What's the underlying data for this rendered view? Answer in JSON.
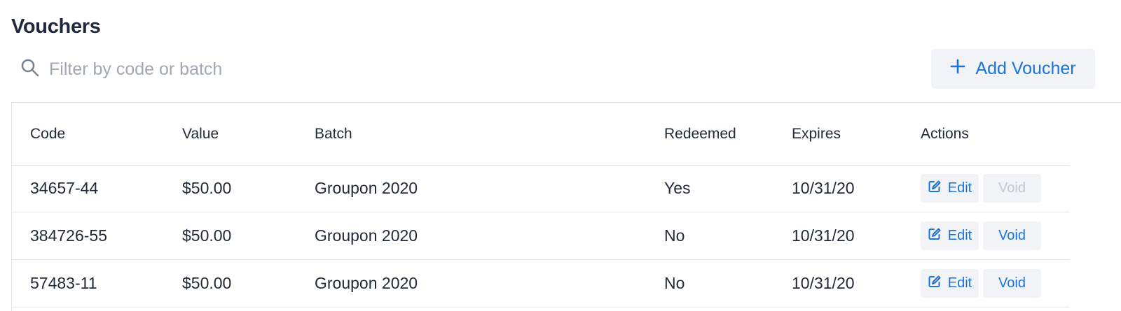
{
  "page": {
    "title": "Vouchers"
  },
  "filter": {
    "placeholder": "Filter by code or batch",
    "value": "",
    "icon": "search-icon"
  },
  "add_button": {
    "label": "Add Voucher",
    "icon": "plus-icon"
  },
  "colors": {
    "accent": "#1a73d9",
    "button_bg": "#f1f3f6",
    "disabled_text": "#c3c8cf",
    "title": "#1e293b"
  },
  "table": {
    "headers": {
      "code": "Code",
      "value": "Value",
      "batch": "Batch",
      "redeemed": "Redeemed",
      "expires": "Expires",
      "actions": "Actions"
    },
    "rows": [
      {
        "code": "34657-44",
        "value": "$50.00",
        "batch": "Groupon 2020",
        "redeemed": "Yes",
        "expires": "10/31/20",
        "edit_label": "Edit",
        "void_label": "Void",
        "void_disabled": true
      },
      {
        "code": "384726-55",
        "value": "$50.00",
        "batch": "Groupon 2020",
        "redeemed": "No",
        "expires": "10/31/20",
        "edit_label": "Edit",
        "void_label": "Void",
        "void_disabled": false
      },
      {
        "code": "57483-11",
        "value": "$50.00",
        "batch": "Groupon 2020",
        "redeemed": "No",
        "expires": "10/31/20",
        "edit_label": "Edit",
        "void_label": "Void",
        "void_disabled": false
      }
    ]
  }
}
